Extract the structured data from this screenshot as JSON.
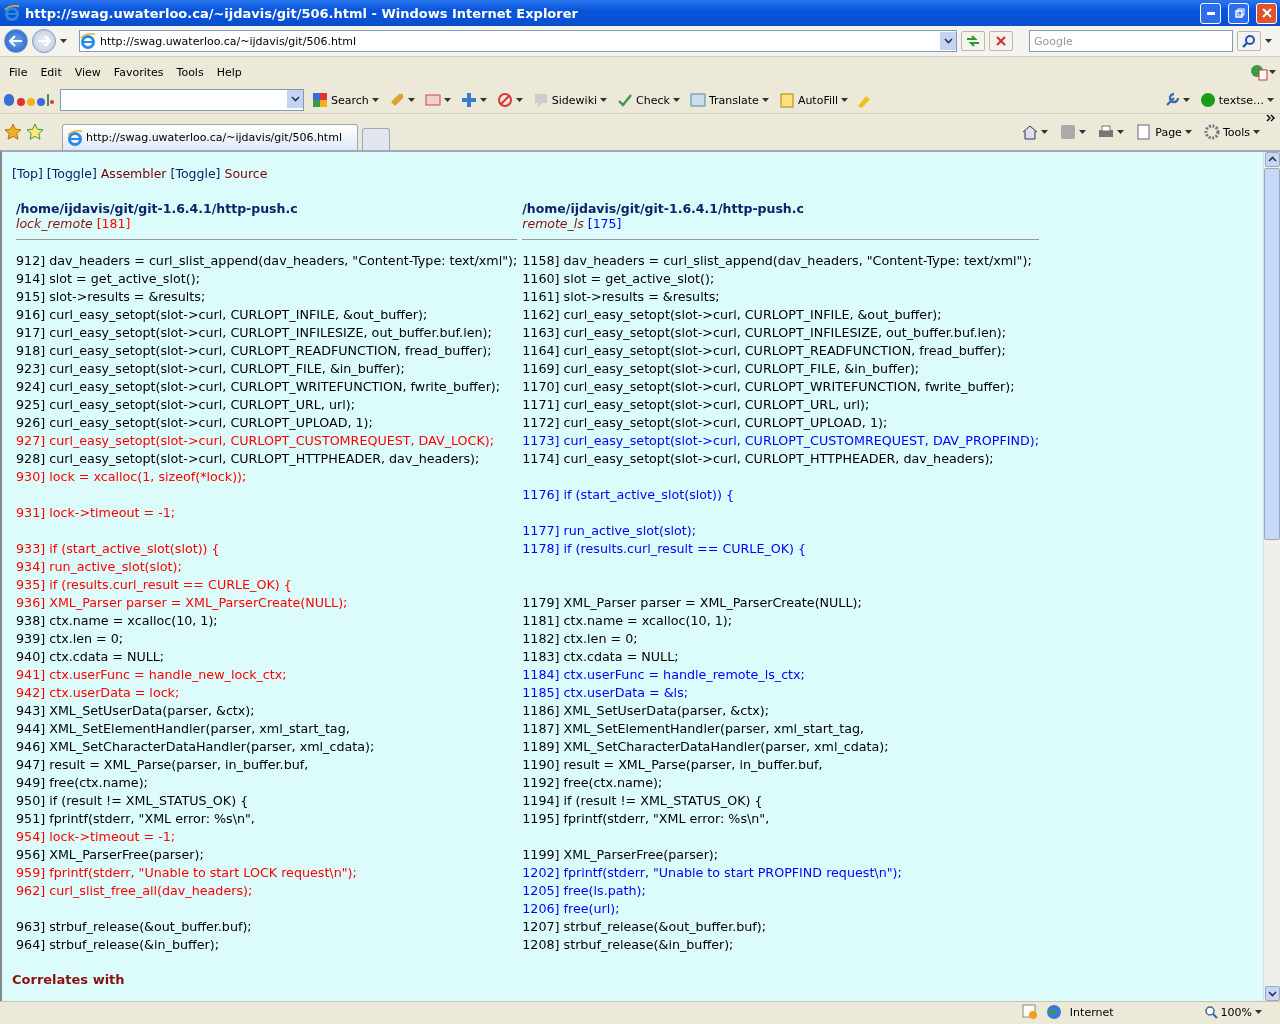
{
  "window": {
    "title": "http://swag.uwaterloo.ca/~ijdavis/git/506.html - Windows Internet Explorer"
  },
  "address_bar": {
    "value": "http://swag.uwaterloo.ca/~ijdavis/git/506.html"
  },
  "search_box": {
    "placeholder": "Google"
  },
  "menu": [
    "File",
    "Edit",
    "View",
    "Favorites",
    "Tools",
    "Help"
  ],
  "google_toolbar": {
    "search_label": "Search",
    "items": [
      "Sidewiki",
      "Check",
      "Translate",
      "AutoFill"
    ],
    "account": "textse…"
  },
  "tabs": [
    {
      "label": "http://swag.uwaterloo.ca/~ijdavis/git/506.html",
      "selected": true
    }
  ],
  "command_bar": [
    "Page",
    "Tools"
  ],
  "page": {
    "nav": [
      {
        "kind": "link",
        "text": "[Top]"
      },
      {
        "kind": "link",
        "text": "[Toggle]"
      },
      {
        "kind": "label",
        "text": "Assembler"
      },
      {
        "kind": "link",
        "text": "[Toggle]"
      },
      {
        "kind": "label",
        "text": "Source"
      }
    ],
    "columns": [
      {
        "file": "/home/ijdavis/git/git-1.6.4.1/http-push.c",
        "function": "lock_remote",
        "count": {
          "text": "[181]",
          "color": "#ff0000"
        },
        "lines": [
          {
            "text": "912] dav_headers = curl_slist_append(dav_headers, \"Content-Type: text/xml\");",
            "color": "#000000"
          },
          {
            "text": "914] slot = get_active_slot();",
            "color": "#000000"
          },
          {
            "text": "915] slot->results = &results;",
            "color": "#000000"
          },
          {
            "text": "916] curl_easy_setopt(slot->curl, CURLOPT_INFILE, &out_buffer);",
            "color": "#000000"
          },
          {
            "text": "917] curl_easy_setopt(slot->curl, CURLOPT_INFILESIZE, out_buffer.buf.len);",
            "color": "#000000"
          },
          {
            "text": "918] curl_easy_setopt(slot->curl, CURLOPT_READFUNCTION, fread_buffer);",
            "color": "#000000"
          },
          {
            "text": "923] curl_easy_setopt(slot->curl, CURLOPT_FILE, &in_buffer);",
            "color": "#000000"
          },
          {
            "text": "924] curl_easy_setopt(slot->curl, CURLOPT_WRITEFUNCTION, fwrite_buffer);",
            "color": "#000000"
          },
          {
            "text": "925] curl_easy_setopt(slot->curl, CURLOPT_URL, url);",
            "color": "#000000"
          },
          {
            "text": "926] curl_easy_setopt(slot->curl, CURLOPT_UPLOAD, 1);",
            "color": "#000000"
          },
          {
            "text": "927] curl_easy_setopt(slot->curl, CURLOPT_CUSTOMREQUEST, DAV_LOCK);",
            "color": "#ff0000"
          },
          {
            "text": "928] curl_easy_setopt(slot->curl, CURLOPT_HTTPHEADER, dav_headers);",
            "color": "#000000"
          },
          {
            "text": "930] lock = xcalloc(1, sizeof(*lock));",
            "color": "#ff0000"
          },
          {
            "kind": "blank"
          },
          {
            "text": "931] lock->timeout = -1;",
            "color": "#ff0000"
          },
          {
            "kind": "blank"
          },
          {
            "text": "933] if (start_active_slot(slot)) {",
            "color": "#ff0000"
          },
          {
            "text": "934] run_active_slot(slot);",
            "color": "#ff0000"
          },
          {
            "text": "935] if (results.curl_result == CURLE_OK) {",
            "color": "#ff0000"
          },
          {
            "text": "936] XML_Parser parser = XML_ParserCreate(NULL);",
            "color": "#ff0000"
          },
          {
            "text": "938] ctx.name = xcalloc(10, 1);",
            "color": "#000000"
          },
          {
            "text": "939] ctx.len = 0;",
            "color": "#000000"
          },
          {
            "text": "940] ctx.cdata = NULL;",
            "color": "#000000"
          },
          {
            "text": "941] ctx.userFunc = handle_new_lock_ctx;",
            "color": "#ff0000"
          },
          {
            "text": "942] ctx.userData = lock;",
            "color": "#ff0000"
          },
          {
            "text": "943] XML_SetUserData(parser, &ctx);",
            "color": "#000000"
          },
          {
            "text": "944] XML_SetElementHandler(parser, xml_start_tag,",
            "color": "#000000"
          },
          {
            "text": "946] XML_SetCharacterDataHandler(parser, xml_cdata);",
            "color": "#000000"
          },
          {
            "text": "947] result = XML_Parse(parser, in_buffer.buf,",
            "color": "#000000"
          },
          {
            "text": "949] free(ctx.name);",
            "color": "#000000"
          },
          {
            "text": "950] if (result != XML_STATUS_OK) {",
            "color": "#000000"
          },
          {
            "text": "951] fprintf(stderr, \"XML error: %s\\n\",",
            "color": "#000000"
          },
          {
            "text": "954] lock->timeout = -1;",
            "color": "#ff0000"
          },
          {
            "text": "956] XML_ParserFree(parser);",
            "color": "#000000"
          },
          {
            "text": "959] fprintf(stderr, \"Unable to start LOCK request\\n\");",
            "color": "#ff0000"
          },
          {
            "text": "962] curl_slist_free_all(dav_headers);",
            "color": "#ff0000"
          },
          {
            "kind": "blank"
          },
          {
            "text": "963] strbuf_release(&out_buffer.buf);",
            "color": "#000000"
          },
          {
            "text": "964] strbuf_release(&in_buffer);",
            "color": "#000000"
          }
        ]
      },
      {
        "file": "/home/ijdavis/git/git-1.6.4.1/http-push.c",
        "function": "remote_ls",
        "count": {
          "text": "[175]",
          "color": "#0000ff"
        },
        "lines": [
          {
            "text": "1158] dav_headers = curl_slist_append(dav_headers, \"Content-Type: text/xml\");",
            "color": "#000000"
          },
          {
            "text": "1160] slot = get_active_slot();",
            "color": "#000000"
          },
          {
            "text": "1161] slot->results = &results;",
            "color": "#000000"
          },
          {
            "text": "1162] curl_easy_setopt(slot->curl, CURLOPT_INFILE, &out_buffer);",
            "color": "#000000"
          },
          {
            "text": "1163] curl_easy_setopt(slot->curl, CURLOPT_INFILESIZE, out_buffer.buf.len);",
            "color": "#000000"
          },
          {
            "text": "1164] curl_easy_setopt(slot->curl, CURLOPT_READFUNCTION, fread_buffer);",
            "color": "#000000"
          },
          {
            "text": "1169] curl_easy_setopt(slot->curl, CURLOPT_FILE, &in_buffer);",
            "color": "#000000"
          },
          {
            "text": "1170] curl_easy_setopt(slot->curl, CURLOPT_WRITEFUNCTION, fwrite_buffer);",
            "color": "#000000"
          },
          {
            "text": "1171] curl_easy_setopt(slot->curl, CURLOPT_URL, url);",
            "color": "#000000"
          },
          {
            "text": "1172] curl_easy_setopt(slot->curl, CURLOPT_UPLOAD, 1);",
            "color": "#000000"
          },
          {
            "text": "1173] curl_easy_setopt(slot->curl, CURLOPT_CUSTOMREQUEST, DAV_PROPFIND);",
            "color": "#0000ff"
          },
          {
            "text": "1174] curl_easy_setopt(slot->curl, CURLOPT_HTTPHEADER, dav_headers);",
            "color": "#000000"
          },
          {
            "kind": "blank"
          },
          {
            "text": "1176] if (start_active_slot(slot)) {",
            "color": "#0000ff"
          },
          {
            "kind": "blank"
          },
          {
            "text": "1177] run_active_slot(slot);",
            "color": "#0000ff"
          },
          {
            "text": "1178] if (results.curl_result == CURLE_OK) {",
            "color": "#0000ff"
          },
          {
            "kind": "blank"
          },
          {
            "kind": "blank"
          },
          {
            "text": "1179] XML_Parser parser = XML_ParserCreate(NULL);",
            "color": "#000000"
          },
          {
            "text": "1181] ctx.name = xcalloc(10, 1);",
            "color": "#000000"
          },
          {
            "text": "1182] ctx.len = 0;",
            "color": "#000000"
          },
          {
            "text": "1183] ctx.cdata = NULL;",
            "color": "#000000"
          },
          {
            "text": "1184] ctx.userFunc = handle_remote_ls_ctx;",
            "color": "#0000ff"
          },
          {
            "text": "1185] ctx.userData = &ls;",
            "color": "#0000ff"
          },
          {
            "text": "1186] XML_SetUserData(parser, &ctx);",
            "color": "#000000"
          },
          {
            "text": "1187] XML_SetElementHandler(parser, xml_start_tag,",
            "color": "#000000"
          },
          {
            "text": "1189] XML_SetCharacterDataHandler(parser, xml_cdata);",
            "color": "#000000"
          },
          {
            "text": "1190] result = XML_Parse(parser, in_buffer.buf,",
            "color": "#000000"
          },
          {
            "text": "1192] free(ctx.name);",
            "color": "#000000"
          },
          {
            "text": "1194] if (result != XML_STATUS_OK) {",
            "color": "#000000"
          },
          {
            "text": "1195] fprintf(stderr, \"XML error: %s\\n\",",
            "color": "#000000"
          },
          {
            "kind": "blank"
          },
          {
            "text": "1199] XML_ParserFree(parser);",
            "color": "#000000"
          },
          {
            "text": "1202] fprintf(stderr, \"Unable to start PROPFIND request\\n\");",
            "color": "#0000ff"
          },
          {
            "text": "1205] free(ls.path);",
            "color": "#0000ff"
          },
          {
            "text": "1206] free(url);",
            "color": "#0000ff"
          },
          {
            "text": "1207] strbuf_release(&out_buffer.buf);",
            "color": "#000000"
          },
          {
            "text": "1208] strbuf_release(&in_buffer);",
            "color": "#000000"
          }
        ]
      }
    ],
    "section_heading": "Correlates with"
  },
  "status_bar": {
    "zone": "Internet",
    "zoom": "100%"
  }
}
